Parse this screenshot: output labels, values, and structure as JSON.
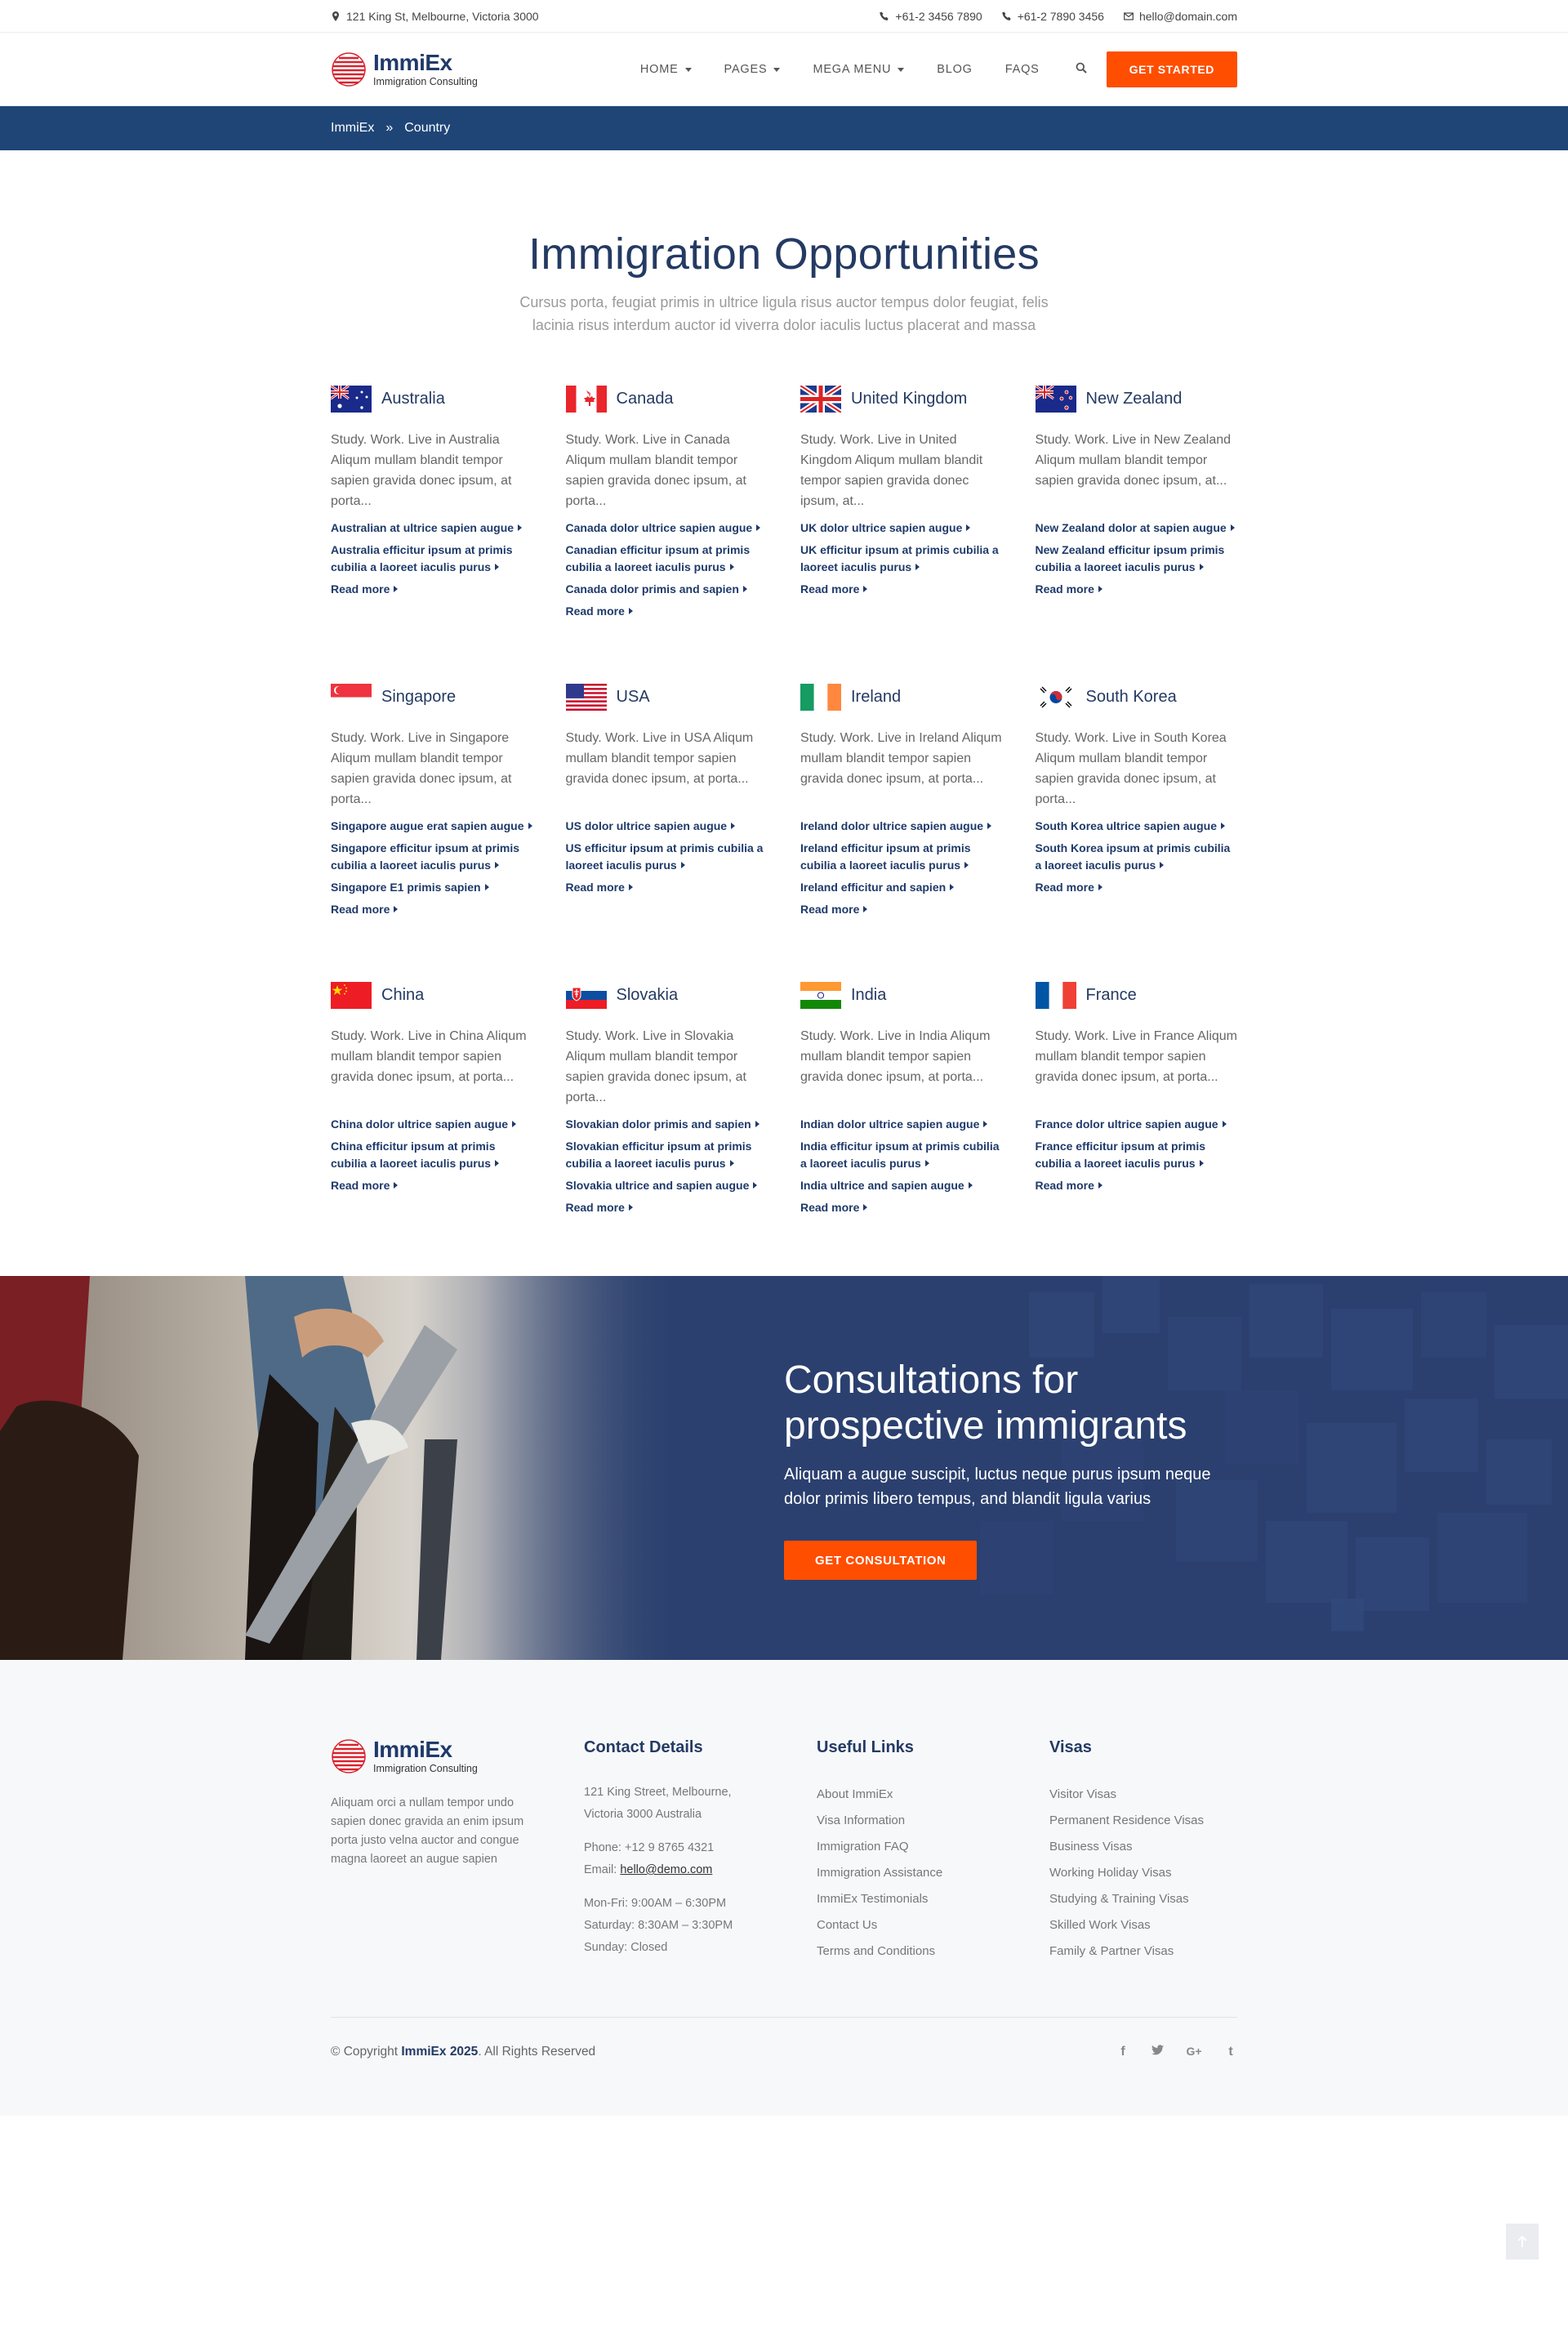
{
  "topbar": {
    "address": "121 King St, Melbourne, Victoria 3000",
    "phone1": "+61-2 3456 7890",
    "phone2": "+61-2 7890 3456",
    "email": "hello@domain.com"
  },
  "header": {
    "brand": "ImmiEx",
    "tagline": "Immigration Consulting",
    "nav": {
      "home": "HOME",
      "pages": "PAGES",
      "mega": "MEGA MENU",
      "blog": "BLOG",
      "faqs": "FAQS"
    },
    "cta": "GET STARTED"
  },
  "breadcrumb": {
    "home": "ImmiEx",
    "sep": "»",
    "current": "Country"
  },
  "section": {
    "title": "Immigration Opportunities",
    "subtitle": "Cursus porta, feugiat primis in ultrice ligula risus auctor tempus dolor feugiat, felis lacinia risus interdum auctor id viverra dolor iaculis luctus placerat and massa"
  },
  "countries": [
    {
      "name": "Australia",
      "flag": "australia-flag",
      "desc": "Study. Work. Live in Australia Aliqum mullam blandit tempor sapien gravida donec ipsum, at porta...",
      "links": [
        "Australian at ultrice sapien augue",
        "Australia efficitur ipsum at primis cubilia a laoreet iaculis purus"
      ],
      "more": "Read more"
    },
    {
      "name": "Canada",
      "flag": "canada-flag",
      "desc": "Study. Work. Live in Canada Aliqum mullam blandit tempor sapien gravida donec ipsum, at porta...",
      "links": [
        "Canada dolor ultrice sapien augue",
        "Canadian efficitur ipsum at primis cubilia a laoreet iaculis purus",
        "Canada dolor primis and sapien"
      ],
      "more": "Read more"
    },
    {
      "name": "United Kingdom",
      "flag": "uk-flag",
      "desc": "Study. Work. Live in United Kingdom Aliqum mullam blandit tempor sapien gravida donec ipsum, at...",
      "links": [
        "UK dolor ultrice sapien augue",
        "UK efficitur ipsum at primis cubilia a laoreet iaculis purus"
      ],
      "more": "Read more"
    },
    {
      "name": "New Zealand",
      "flag": "new-zealand-flag",
      "desc": "Study. Work. Live in New Zealand Aliqum mullam blandit tempor sapien gravida donec ipsum, at...",
      "links": [
        "New Zealand dolor at sapien augue",
        "New Zealand efficitur ipsum primis cubilia a laoreet iaculis purus"
      ],
      "more": "Read more"
    },
    {
      "name": "Singapore",
      "flag": "singapore-flag",
      "desc": "Study. Work. Live in Singapore Aliqum mullam blandit tempor sapien gravida donec ipsum, at porta...",
      "links": [
        "Singapore augue erat sapien augue",
        "Singapore efficitur ipsum at primis cubilia a laoreet iaculis purus",
        "Singapore E1 primis sapien"
      ],
      "more": "Read more"
    },
    {
      "name": "USA",
      "flag": "usa-flag",
      "desc": "Study. Work. Live in USA Aliqum mullam blandit tempor sapien gravida donec ipsum, at porta...",
      "links": [
        "US dolor ultrice sapien augue",
        "US efficitur ipsum at primis cubilia a laoreet iaculis purus"
      ],
      "more": "Read more"
    },
    {
      "name": "Ireland",
      "flag": "ireland-flag",
      "desc": "Study. Work. Live in Ireland Aliqum mullam blandit tempor sapien gravida donec ipsum, at porta...",
      "links": [
        "Ireland dolor ultrice sapien augue",
        "Ireland efficitur ipsum at primis cubilia a laoreet iaculis purus",
        "Ireland efficitur and sapien"
      ],
      "more": "Read more"
    },
    {
      "name": "South Korea",
      "flag": "south-korea-flag",
      "desc": "Study. Work. Live in South Korea Aliqum mullam blandit tempor sapien gravida donec ipsum, at porta...",
      "links": [
        "South Korea ultrice sapien augue",
        "South Korea ipsum at primis cubilia a laoreet iaculis purus"
      ],
      "more": "Read more"
    },
    {
      "name": "China",
      "flag": "china-flag",
      "desc": "Study. Work. Live in China Aliqum mullam blandit tempor sapien gravida donec ipsum, at porta...",
      "links": [
        "China dolor ultrice sapien augue",
        "China efficitur ipsum at primis cubilia a laoreet iaculis purus"
      ],
      "more": "Read more"
    },
    {
      "name": "Slovakia",
      "flag": "slovakia-flag",
      "desc": "Study. Work. Live in Slovakia Aliqum mullam blandit tempor sapien gravida donec ipsum, at porta...",
      "links": [
        "Slovakian dolor primis and sapien",
        "Slovakian efficitur ipsum at primis cubilia a laoreet iaculis purus",
        "Slovakia ultrice and sapien augue"
      ],
      "more": "Read more"
    },
    {
      "name": "India",
      "flag": "india-flag",
      "desc": "Study. Work. Live in India Aliqum mullam blandit tempor sapien gravida donec ipsum, at porta...",
      "links": [
        "Indian dolor ultrice sapien augue",
        "India efficitur ipsum at primis cubilia a laoreet iaculis purus",
        "India ultrice and sapien augue"
      ],
      "more": "Read more"
    },
    {
      "name": "France",
      "flag": "france-flag",
      "desc": "Study. Work. Live in France Aliqum mullam blandit tempor sapien gravida donec ipsum, at porta...",
      "links": [
        "France dolor ultrice sapien augue",
        "France efficitur ipsum at primis cubilia a laoreet iaculis purus"
      ],
      "more": "Read more"
    }
  ],
  "consult": {
    "title": "Consultations for prospective immigrants",
    "text": "Aliquam a augue suscipit, luctus neque purus ipsum neque dolor primis libero tempus, and blandit ligula varius",
    "cta": "GET CONSULTATION"
  },
  "footer": {
    "about": "Aliquam orci a nullam tempor undo sapien donec gravida an enim ipsum porta justo velna auctor and congue magna laoreet an augue sapien",
    "contact": {
      "title": "Contact Details",
      "addr1": "121 King Street, Melbourne,",
      "addr2": "Victoria 3000 Australia",
      "phone": "Phone: +12 9 8765 4321",
      "email_label": "Email: ",
      "email": "hello@demo.com",
      "hours1": "Mon-Fri: 9:00AM – 6:30PM",
      "hours2": "Saturday: 8:30AM – 3:30PM",
      "hours3": "Sunday: Closed"
    },
    "useful": {
      "title": "Useful Links",
      "links": [
        "About ImmiEx",
        "Visa Information",
        "Immigration FAQ",
        "Immigration Assistance",
        "ImmiEx Testimonials",
        "Contact Us",
        "Terms and Conditions"
      ]
    },
    "visas": {
      "title": "Visas",
      "links": [
        "Visitor Visas",
        "Permanent Residence Visas",
        "Business Visas",
        "Working Holiday Visas",
        "Studying & Training Visas",
        "Skilled Work Visas",
        "Family & Partner Visas"
      ]
    },
    "copyright_pre": "© Copyright ",
    "copyright_brand": "ImmiEx 2025",
    "copyright_post": ". All Rights Reserved",
    "social": {
      "facebook": "f",
      "twitter": "twitter-icon",
      "google": "G+",
      "tumblr": "t"
    }
  },
  "colors": {
    "accent": "#ff4e00",
    "navy": "#1f4577",
    "heading": "#243a63"
  }
}
